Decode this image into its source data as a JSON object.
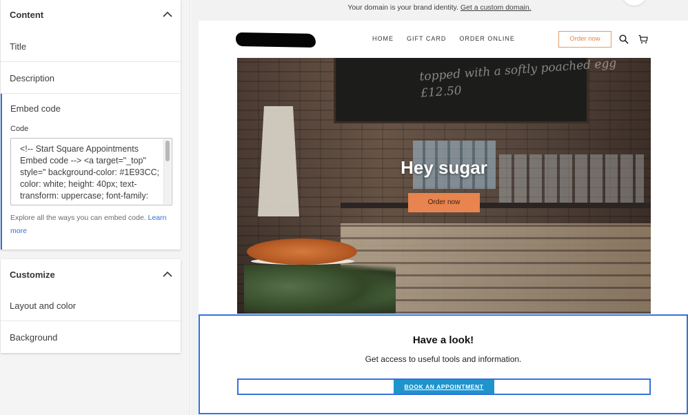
{
  "content_panel": {
    "title": "Content",
    "rows": [
      {
        "label": "Title"
      },
      {
        "label": "Description"
      }
    ],
    "embed": {
      "title": "Embed code",
      "code_label": "Code",
      "code_value": "<!-- Start Square Appointments Embed code --> <a target=\"_top\" style=\" background-color: #1E93CC; color: white; height: 40px; text-transform: uppercase; font-family:",
      "help_text": "Explore all the ways you can embed code.",
      "help_link": "Learn more"
    }
  },
  "customize_panel": {
    "title": "Customize",
    "rows": [
      {
        "label": "Layout and color"
      },
      {
        "label": "Background"
      }
    ]
  },
  "domain_bar": {
    "text": "Your domain is your brand identity.",
    "link": "Get a custom domain."
  },
  "site_header": {
    "nav": [
      "HOME",
      "GIFT CARD",
      "ORDER ONLINE"
    ],
    "order_button": "Order now"
  },
  "hero": {
    "chalk_text": "topped with a softly poached egg £12.50",
    "title": "Hey sugar",
    "button": "Order now"
  },
  "look_section": {
    "title": "Have a look!",
    "subtitle": "Get access to useful tools and information.",
    "button": "BOOK AN APPOINTMENT",
    "button_color": "#1E93CC"
  },
  "colors": {
    "accent": "#3471de",
    "order_orange": "#e8844f"
  }
}
